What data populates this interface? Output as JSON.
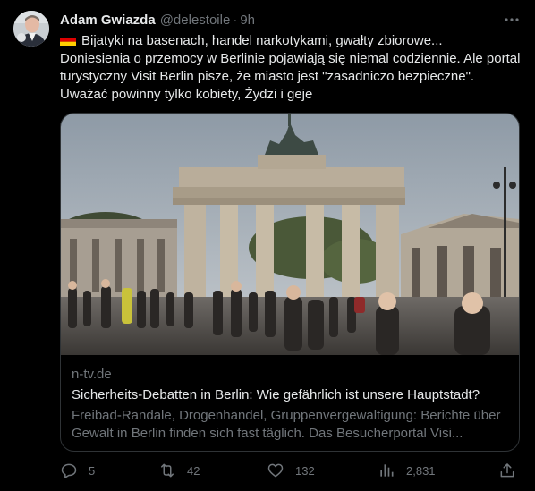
{
  "author": {
    "name": "Adam Gwiazda",
    "handle": "@delestoile",
    "separator": "·",
    "time": "9h"
  },
  "tweet": {
    "flag_icon": "germany-flag-icon",
    "text": "Bijatyki na basenach, handel narkotykami, gwałty zbiorowe...\nDoniesienia o przemocy w Berlinie pojawiają się niemal codziennie. Ale portal turystyczny Visit Berlin pisze, że miasto jest \"zasadniczo bezpieczne\". Uważać powinny tylko kobiety, Żydzi i geje"
  },
  "card": {
    "domain": "n-tv.de",
    "title": "Sicherheits-Debatten in Berlin: Wie gefährlich ist unsere Hauptstadt?",
    "description": "Freibad-Randale, Drogenhandel, Gruppenvergewaltigung: Berichte über Gewalt in Berlin finden sich fast täglich. Das Besucherportal Visi..."
  },
  "actions": {
    "replies": "5",
    "reposts": "42",
    "likes": "132",
    "views": "2,831"
  },
  "colors": {
    "background": "#000000",
    "text_primary": "#e7e9ea",
    "text_secondary": "#71767b",
    "border": "#2f3336"
  }
}
